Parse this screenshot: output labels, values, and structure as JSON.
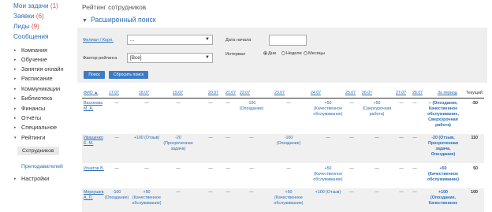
{
  "sidebar": {
    "top_links": [
      {
        "label": "Мои задачи",
        "count": "(1)"
      },
      {
        "label": "Заявки",
        "count": "(6)"
      },
      {
        "label": "Лиды",
        "count": "(9)"
      },
      {
        "label": "Сообщения",
        "count": ""
      }
    ],
    "items": [
      {
        "label": "Компания",
        "arrow": "▸"
      },
      {
        "label": "Обучение",
        "arrow": "▸"
      },
      {
        "label": "Занятия онлайн",
        "arrow": "▸"
      },
      {
        "label": "Расписание",
        "arrow": "▸"
      },
      {
        "label": "Коммуникации",
        "arrow": "▸"
      },
      {
        "label": "Библиотека",
        "arrow": "▸"
      },
      {
        "label": "Финансы",
        "arrow": "▸"
      },
      {
        "label": "Отчёты",
        "arrow": "▸"
      },
      {
        "label": "Специальное",
        "arrow": "▸"
      },
      {
        "label": "Рейтинги",
        "arrow": "▾"
      }
    ],
    "sub_items": [
      "Сотрудников",
      "Преподавателей"
    ],
    "settings": {
      "label": "Настройки",
      "arrow": "▸"
    }
  },
  "page_title": "Рейтинг сотрудников",
  "search": {
    "heading": "Расширенный поиск",
    "branch_label": "Филиал / Корп.",
    "branch_value": "...",
    "factor_label": "Фактор рейтинга",
    "factor_value": "[Все]",
    "start_label": "Дата начала",
    "start_value": "",
    "interval_label": "Интервал",
    "interval_options": [
      "Дни",
      "Недели",
      "Месяцы"
    ],
    "search_button": "Поиск",
    "reset_button": "Сбросить поиск"
  },
  "table": {
    "headers": [
      "ФИО ▲",
      "17.07",
      "18.07",
      "19.07",
      "20.07",
      "21.07",
      "22.07",
      "23.07",
      "24.07",
      "25.07",
      "26.07",
      "27.07",
      "28.07",
      "Зa период",
      "Текущий"
    ],
    "rows": [
      {
        "name": "Васюкова М. А.",
        "cells": [
          [
            "—"
          ],
          [
            "—"
          ],
          [
            "—"
          ],
          [
            "—"
          ],
          [
            "—"
          ],
          [
            "-100",
            "(Опоздание)"
          ],
          [
            "—"
          ],
          [
            "+50",
            "(Качественное",
            "обслуживание)"
          ],
          [
            "—"
          ],
          [
            "+50",
            "(Сверхурочная",
            "работа)"
          ],
          [
            "—"
          ],
          [
            "—"
          ]
        ],
        "period": [
          "-- (Опоздание,",
          "Качественное",
          "обслуживание,",
          "Сверхурочная",
          "работа)"
        ],
        "current": "-50"
      },
      {
        "name": "Иващенко Е. М.",
        "cells": [
          [
            "—"
          ],
          [
            "+100 (Отзыв)"
          ],
          [
            "-20",
            "(Просроченная",
            "задача)"
          ],
          [
            "—"
          ],
          [
            "—"
          ],
          [
            "—"
          ],
          [
            "-100",
            "(Опоздание)"
          ],
          [
            "—"
          ],
          [
            "—"
          ],
          [
            "—"
          ],
          [
            "—"
          ],
          [
            "—"
          ]
        ],
        "period": [
          "-20 (Отзыв,",
          "Просроченная",
          "задача,",
          "Опоздание)"
        ],
        "current": "110"
      },
      {
        "name": "Игнатов В.",
        "cells": [
          [
            "—"
          ],
          [
            "—"
          ],
          [
            "—"
          ],
          [
            "—"
          ],
          [
            "—"
          ],
          [
            "—"
          ],
          [
            "—"
          ],
          [
            "+50",
            "(Качественное",
            "обслуживание)"
          ],
          [
            "—"
          ],
          [
            "—"
          ],
          [
            "—"
          ],
          [
            "—"
          ]
        ],
        "period": [
          "+50",
          "(Качественное",
          "обслуживание)"
        ],
        "current": "50"
      },
      {
        "name": "Меркушев А. П.",
        "cells": [
          [
            "-100",
            "(Опоздание)"
          ],
          [
            "+50",
            "(Качественное",
            "обслуживание)"
          ],
          [
            "—"
          ],
          [
            "—"
          ],
          [
            "—"
          ],
          [
            "—"
          ],
          [
            "+50",
            "(Качественное",
            "обслуживание)"
          ],
          [
            "+100 (Отзыв)"
          ],
          [
            "—"
          ],
          [
            "—"
          ],
          [
            "—"
          ],
          [
            "—"
          ]
        ],
        "period": [
          "+100",
          "(Опоздание,",
          "Качественное"
        ],
        "current": "100"
      }
    ]
  },
  "colors": {
    "accent": "#2a6db5",
    "button": "#3d7cc5",
    "count": "#d9534f",
    "panel": "#efefef"
  }
}
